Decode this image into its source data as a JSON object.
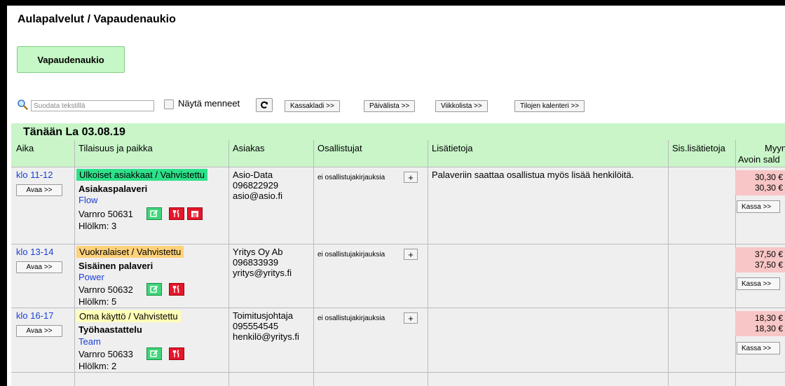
{
  "header": {
    "title": "Aulapalvelut / Vapaudenaukio",
    "venue_button": "Vapaudenaukio"
  },
  "toolbar": {
    "search_placeholder": "Suodata tekstillä",
    "show_past_label": "Näytä menneet",
    "kassakladi": "Kassakladi >>",
    "paivalista": "Päivälista >>",
    "viikkolista": "Viikkolista >>",
    "tilojen_kalenteri": "Tilojen kalenteri >>"
  },
  "day": {
    "title": "Tänään La 03.08.19",
    "columns": {
      "aika": "Aika",
      "tilaisuus": "Tilaisuus ja paikka",
      "asiakas": "Asiakas",
      "osallistujat": "Osallistujat",
      "lisatietoja": "Lisätietoja",
      "sis_lisatietoja": "Sis.lisätietoja",
      "myynti": "Myyn",
      "avoin_saldo": "Avoin sald"
    },
    "open_button": "Avaa >>",
    "kassa_button": "Kassa >>",
    "no_participants": "ei osallistujakirjauksia",
    "plus": "+",
    "rows": [
      {
        "time": "klo 11-12",
        "status": "Ulkoiset asiakkaat / Vahvistettu",
        "status_color": "#2ee08a",
        "title": "Asiakaspalaveri",
        "room": "Flow",
        "varnro": "Varnro 50631",
        "holkm": "Hlölkm: 3",
        "customer_name": "Asio-Data",
        "customer_phone": "096822929",
        "customer_email": "asio@asio.fi",
        "notes": "Palaveriin saattaa osallistua myös lisää henkilöitä.",
        "sales": "30,30 €",
        "balance": "30,30 €",
        "icons": [
          "edit-icon",
          "food-icon",
          "calendar-icon"
        ]
      },
      {
        "time": "klo 13-14",
        "status": "Vuokralaiset / Vahvistettu",
        "status_color": "#ffd27a",
        "title": "Sisäinen palaveri",
        "room": "Power",
        "varnro": "Varnro 50632",
        "holkm": "Hlölkm: 5",
        "customer_name": "Yritys Oy Ab",
        "customer_phone": "096833939",
        "customer_email": "yritys@yritys.fi",
        "notes": "",
        "sales": "37,50 €",
        "balance": "37,50 €",
        "icons": [
          "edit-icon",
          "food-icon"
        ]
      },
      {
        "time": "klo 16-17",
        "status": "Oma käyttö / Vahvistettu",
        "status_color": "#ffffb8",
        "title": "Työhaastattelu",
        "room": "Team",
        "varnro": "Varnro 50633",
        "holkm": "Hlölkm: 2",
        "customer_name": "Toimitusjohtaja",
        "customer_phone": "095554545",
        "customer_email": "henkilö@yritys.fi",
        "notes": "",
        "sales": "18,30 €",
        "balance": "18,30 €",
        "icons": [
          "edit-icon",
          "food-icon"
        ]
      }
    ]
  }
}
